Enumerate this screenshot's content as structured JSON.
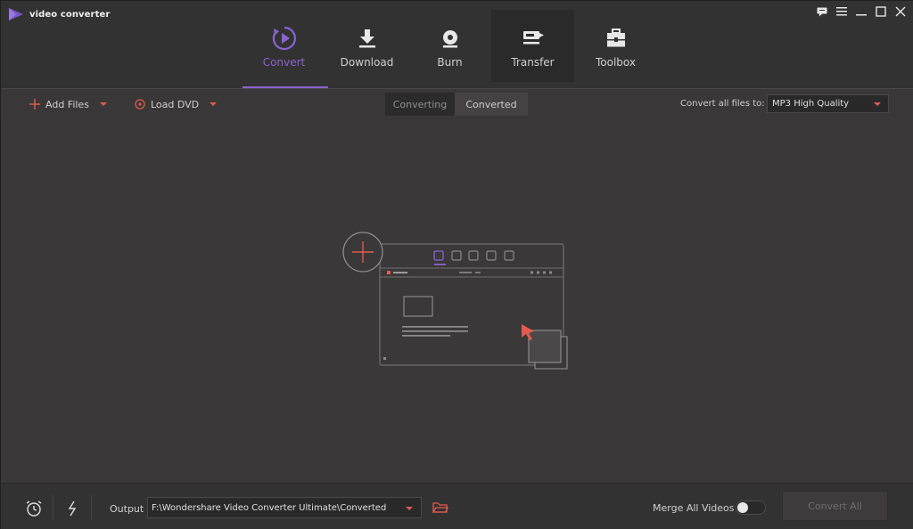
{
  "app": {
    "title": "video converter"
  },
  "window_controls": [
    "feedback-icon",
    "menu-icon",
    "minimize-icon",
    "maximize-icon",
    "close-icon"
  ],
  "tabs": [
    {
      "label": "Convert",
      "icon": "convert-icon",
      "active": true
    },
    {
      "label": "Download",
      "icon": "download-icon",
      "active": false
    },
    {
      "label": "Burn",
      "icon": "burn-icon",
      "active": false
    },
    {
      "label": "Transfer",
      "icon": "transfer-icon",
      "active": false
    },
    {
      "label": "Toolbox",
      "icon": "toolbox-icon",
      "active": false
    }
  ],
  "toolbar": {
    "add_files": "Add Files",
    "load_dvd": "Load DVD",
    "converting": "Converting",
    "converted": "Converted",
    "convert_all_label": "Convert all files to:",
    "format": "MP3 High Quality"
  },
  "footer": {
    "output_label": "Output",
    "output_path": "F:\\Wondershare Video Converter Ultimate\\Converted",
    "merge_label": "Merge All Videos",
    "merge_enabled": false,
    "convert_all": "Convert All"
  },
  "colors": {
    "accent": "#8a63d2",
    "highlight": "#e25b4e",
    "background": "#3a3838",
    "header": "#333232"
  }
}
